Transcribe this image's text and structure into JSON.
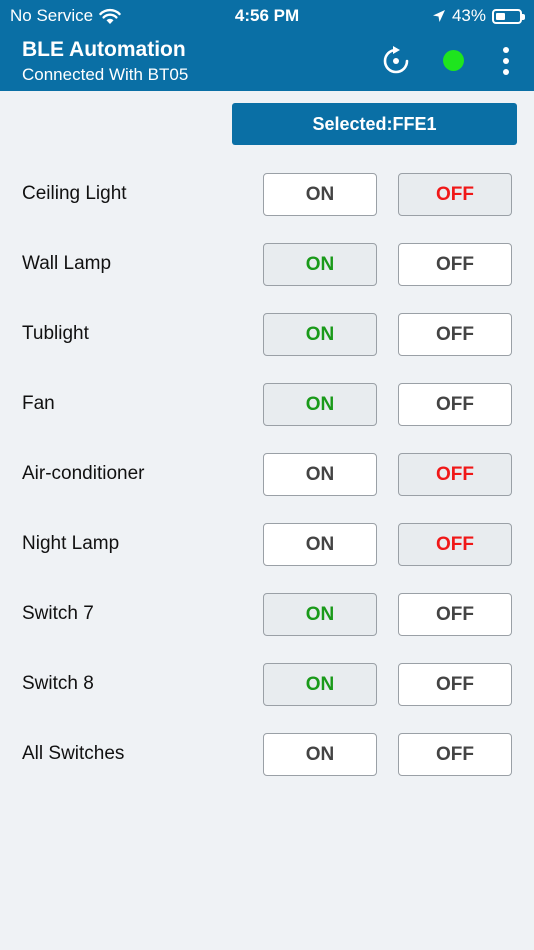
{
  "status_bar": {
    "carrier": "No Service",
    "time": "4:56 PM",
    "battery": "43%",
    "battery_level": 0.43
  },
  "app_bar": {
    "title": "BLE Automation",
    "subtitle": "Connected With BT05",
    "connection_color": "#1ee51e",
    "bar_color": "#0a6fa5"
  },
  "selected": {
    "label": "Selected:FFE1"
  },
  "switches": [
    {
      "label": "Ceiling Light",
      "on_label": "ON",
      "off_label": "OFF",
      "state": "off"
    },
    {
      "label": "Wall Lamp",
      "on_label": "ON",
      "off_label": "OFF",
      "state": "on"
    },
    {
      "label": "Tublight",
      "on_label": "ON",
      "off_label": "OFF",
      "state": "on"
    },
    {
      "label": "Fan",
      "on_label": "ON",
      "off_label": "OFF",
      "state": "on"
    },
    {
      "label": "Air-conditioner",
      "on_label": "ON",
      "off_label": "OFF",
      "state": "off"
    },
    {
      "label": "Night Lamp",
      "on_label": "ON",
      "off_label": "OFF",
      "state": "off"
    },
    {
      "label": "Switch 7",
      "on_label": "ON",
      "off_label": "OFF",
      "state": "on"
    },
    {
      "label": "Switch 8",
      "on_label": "ON",
      "off_label": "OFF",
      "state": "on"
    },
    {
      "label": "All Switches",
      "on_label": "ON",
      "off_label": "OFF",
      "state": "none"
    }
  ]
}
